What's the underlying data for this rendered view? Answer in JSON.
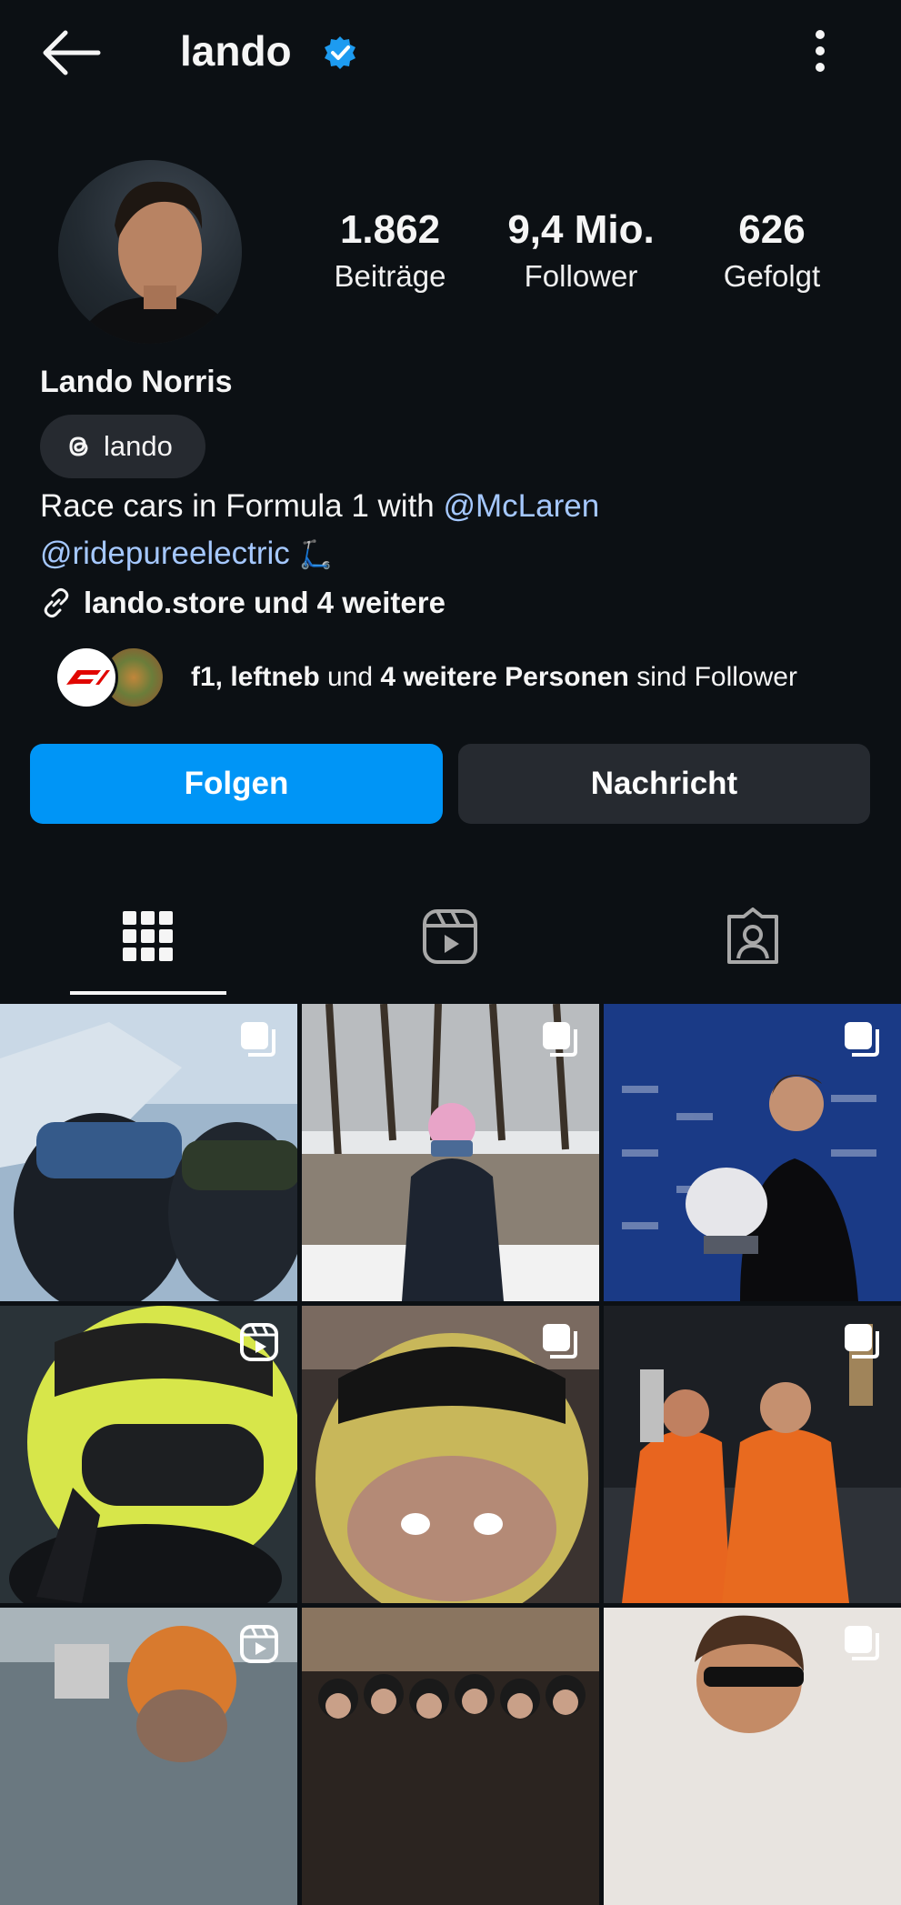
{
  "header": {
    "username": "lando",
    "back_icon": "arrow-left-icon",
    "verified_icon": "verified-badge-icon",
    "menu_icon": "more-vertical-icon"
  },
  "profile": {
    "name": "Lando Norris",
    "stats": [
      {
        "value": "1.862",
        "label": "Beiträge"
      },
      {
        "value": "9,4 Mio.",
        "label": "Follower"
      },
      {
        "value": "626",
        "label": "Gefolgt"
      }
    ],
    "threads_chip": {
      "label": "lando",
      "icon": "threads-icon"
    },
    "bio": {
      "line1_text": "Race cars in Formula 1 with ",
      "line1_mention": "@McLaren",
      "line2_mention": "@ridepureelectric",
      "line2_emoji": "🛴"
    },
    "link": {
      "icon": "link-icon",
      "text": "lando.store und 4 weitere"
    },
    "followed_by": {
      "users": "f1, leftneb",
      "connector": " und ",
      "count_text": "4 weitere Personen",
      "suffix": " sind Follower"
    }
  },
  "actions": {
    "follow_label": "Folgen",
    "message_label": "Nachricht"
  },
  "tabs": [
    {
      "icon": "grid-icon",
      "selected": true
    },
    {
      "icon": "reels-icon",
      "selected": false
    },
    {
      "icon": "tagged-icon",
      "selected": false
    }
  ],
  "colors": {
    "background": "#0c1014",
    "accent": "#0095f6",
    "mention": "#a5c8ff",
    "secondary_button": "#262a30"
  },
  "grid_posts": [
    {
      "badge": "carousel-icon"
    },
    {
      "badge": "carousel-icon"
    },
    {
      "badge": "carousel-icon"
    },
    {
      "badge": "reel-icon"
    },
    {
      "badge": "carousel-icon"
    },
    {
      "badge": "carousel-icon"
    },
    {
      "badge": "reel-icon"
    },
    {
      "badge": "none"
    },
    {
      "badge": "carousel-icon"
    }
  ]
}
